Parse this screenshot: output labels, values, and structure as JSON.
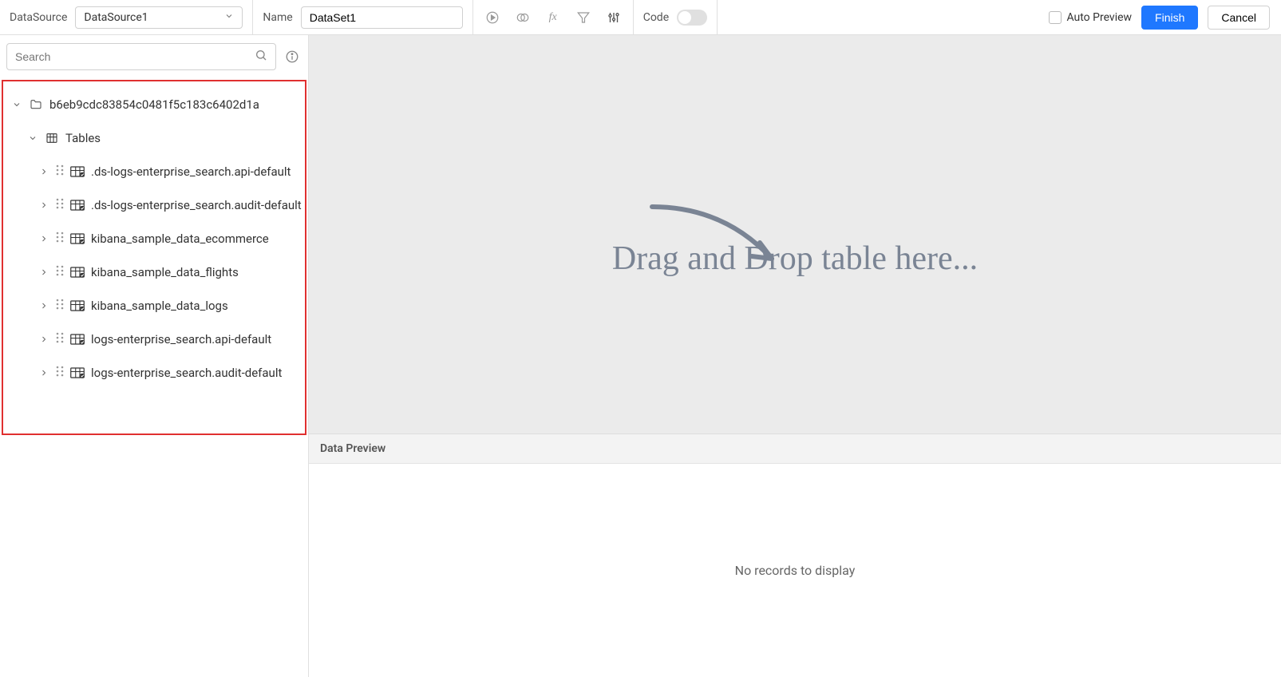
{
  "toolbar": {
    "datasource_label": "DataSource",
    "datasource_value": "DataSource1",
    "name_label": "Name",
    "name_value": "DataSet1",
    "code_label": "Code",
    "auto_preview_label": "Auto Preview",
    "finish_label": "Finish",
    "cancel_label": "Cancel"
  },
  "sidebar": {
    "search_placeholder": "Search",
    "root_folder": "b6eb9cdc83854c0481f5c183c6402d1a",
    "tables_label": "Tables",
    "tables": [
      ".ds-logs-enterprise_search.api-default",
      ".ds-logs-enterprise_search.audit-default",
      "kibana_sample_data_ecommerce",
      "kibana_sample_data_flights",
      "kibana_sample_data_logs",
      "logs-enterprise_search.api-default",
      "logs-enterprise_search.audit-default"
    ]
  },
  "main": {
    "drop_hint": "Drag and Drop table here...",
    "preview_label": "Data Preview",
    "no_records": "No records to display"
  }
}
